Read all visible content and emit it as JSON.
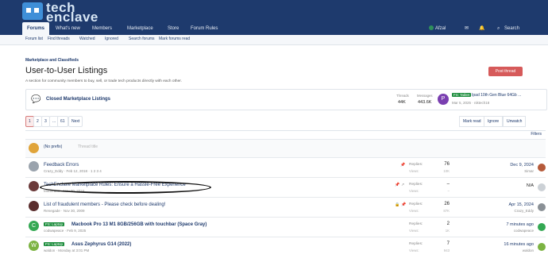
{
  "header": {
    "logo_line1": "tech",
    "logo_line2": "enclave"
  },
  "nav": {
    "items": [
      "Forums",
      "What's new",
      "Members",
      "Marketplace",
      "Store",
      "Forum Rules"
    ],
    "user": "Afzal",
    "search": "Search"
  },
  "subnav": [
    "Forum list",
    "Find threads",
    "Watched",
    "Ignored",
    "Search forums",
    "Mark forums read"
  ],
  "breadcrumb": "Marketplace and Classifieds",
  "page": {
    "title": "User-to-User Listings",
    "description": "A section for community members to buy, sell, or trade tech products directly with each other.",
    "post_thread": "Post thread"
  },
  "closed": {
    "title": "Closed Marketplace Listings",
    "threads_label": "Threads",
    "threads_value": "44K",
    "messages_label": "Messages",
    "messages_value": "443.6K",
    "latest_avatar": "P",
    "latest_badge": "FS: Tablet",
    "latest_title": "Ipad 10th Gen Blue 64Gb ...",
    "latest_meta": "Mar 5, 2025 · niktech18"
  },
  "pager": {
    "pages": [
      "1",
      "2",
      "3",
      "...",
      "61"
    ],
    "next": "Next",
    "mark_read": "Mark read",
    "ignore": "Ignore",
    "unwatch": "Unwatch"
  },
  "filters": {
    "label": "Filters",
    "prefix": "(No prefix)",
    "thread_title_placeholder": "Thread title"
  },
  "rows": [
    {
      "title": "Feedback Errors",
      "meta": "Crazy_Eddy · Feb 12, 2018 · 1 2 3 4",
      "replies": "76",
      "views": "10K",
      "last_date": "Dec 9, 2024",
      "last_user": "Simar"
    },
    {
      "title": "TechEnclave Marketplace Rules: Ensure a Hassle-Free Experience",
      "meta": "Moderator · Nov 20, 2024",
      "replies": "–",
      "views": "–",
      "last_date": "N/A",
      "last_user": ""
    },
    {
      "title": "List of fraudulent members - Please check before dealing!",
      "meta": "Renegade · Nov 30, 2009",
      "replies": "26",
      "views": "87K",
      "last_date": "Apr 15, 2024",
      "last_user": "Crazy_Eddy"
    },
    {
      "badge": "FS: Laptop",
      "title": "Macbook Pro 13 M1 8GB/256GB with touchbar (Space Gray)",
      "meta": "codwapeace · Feb 9, 2025",
      "replies": "2",
      "views": "1K",
      "last_date": "7 minutes ago",
      "last_user": "codwapeace",
      "avatar_letter": "C"
    },
    {
      "badge": "FS: Laptop",
      "title": "Asus Zephyrus G14 (2022)",
      "meta": "waldon · Monday at 3:01 PM",
      "replies": "7",
      "views": "943",
      "last_date": "16 minutes ago",
      "last_user": "waldon",
      "avatar_letter": "W"
    }
  ],
  "labels": {
    "replies": "Replies:",
    "views": "Views:"
  },
  "colors": {
    "header": "#1e3a6d",
    "accent": "#d65a5a",
    "badge": "#1e8e3e"
  }
}
